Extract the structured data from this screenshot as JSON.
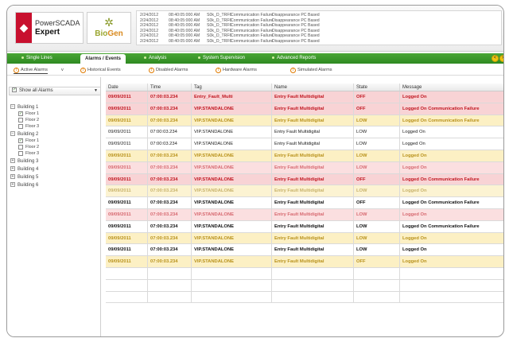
{
  "header": {
    "logo_primary_line1": "PowerSCADA",
    "logo_primary_line2": "Expert",
    "logo_secondary_a": "Bio",
    "logo_secondary_b": "Gen",
    "event_log": [
      {
        "date": "2/24/2012",
        "time": "08:40:05:000 AM",
        "site": "S0k_D_TRF6",
        "msg": "Communication Failure",
        "detail": "Disappearance PC Based"
      },
      {
        "date": "2/24/2012",
        "time": "08:40:05:000 AM",
        "site": "S0k_D_TRF6",
        "msg": "Communication Failure",
        "detail": "Disappearance PC Based"
      },
      {
        "date": "2/24/2012",
        "time": "08:40:05:000 AM",
        "site": "S0k_D_TRF6",
        "msg": "Communication Failure",
        "detail": "Disappearance PC Based"
      },
      {
        "date": "2/24/2012",
        "time": "08:40:05:000 AM",
        "site": "S0k_D_TRF6",
        "msg": "Communication Failure",
        "detail": "Disappearance PC Based"
      },
      {
        "date": "2/24/2012",
        "time": "08:40:05:000 AM",
        "site": "S0k_D_TRF6",
        "msg": "Communication Failure",
        "detail": "Disappearance PC Based"
      },
      {
        "date": "2/24/2012",
        "time": "08:40:05:000 AM",
        "site": "S0k_D_TRF6",
        "msg": "Communication Failure",
        "detail": "Disappearance PC Based"
      }
    ]
  },
  "nav": {
    "items": [
      "Single Lines",
      "Alarms / Events",
      "Analysis",
      "System Supervision",
      "Advanced Reports"
    ],
    "prev_label": "<",
    "next_label": ">"
  },
  "subtabs": {
    "items": [
      "Active Alarms",
      "Historical Events",
      "Disabled Alarms",
      "Hardware Alarms",
      "Simulated Alarms"
    ],
    "dropdown": "v"
  },
  "sidebar": {
    "show_all": "Show all Alarms",
    "tree": [
      {
        "label": "Building 1",
        "floors": [
          "Floor 1",
          "Floor 2",
          "Floor 3"
        ]
      },
      {
        "label": "Building 2",
        "floors": [
          "Floor 1",
          "Floor 2",
          "Floor 3"
        ]
      },
      {
        "label": "Building 3"
      },
      {
        "label": "Building 4"
      },
      {
        "label": "Building 5"
      },
      {
        "label": "Building 6"
      }
    ]
  },
  "table": {
    "columns": [
      "Date",
      "Time",
      "Tag",
      "Name",
      "State",
      "Message"
    ],
    "rows": [
      [
        "09/09/2011",
        "07:00:03.234",
        "Entry_Fault_Multi",
        "Entry Fault Multidigital",
        "OFF",
        "Logged On"
      ],
      [
        "09/09/2011",
        "07:00:03.234",
        "VIP.STANDALONE",
        "Entry Fault Multidigital",
        "OFF",
        "Logged On Communication Failure"
      ],
      [
        "09/09/2011",
        "07:00:03.234",
        "VIP.STANDALONE",
        "Entry Fault Multidigital",
        "LOW",
        "Logged On Communication Failure"
      ],
      [
        "09/09/2011",
        "07:00:03.234",
        "VIP.STANDALONE",
        "Entry Fault Multidigital",
        "LOW",
        "Logged On"
      ],
      [
        "09/09/2011",
        "07:00:03.234",
        "VIP.STANDALONE",
        "Entry Fault Multidigital",
        "LOW",
        "Logged On"
      ],
      [
        "09/09/2011",
        "07:00:03.234",
        "VIP.STANDALONE",
        "Entry Fault Multidigital",
        "LOW",
        "Logged On"
      ],
      [
        "09/09/2011",
        "07:00:03.234",
        "VIP.STANDALONE",
        "Entry Fault Multidigital",
        "LOW",
        "Logged On"
      ],
      [
        "09/09/2011",
        "07:00:03.234",
        "VIP.STANDALONE",
        "Entry Fault Multidigital",
        "OFF",
        "Logged On Communication Failure"
      ],
      [
        "09/09/2011",
        "07:00:03.234",
        "VIP.STANDALONE",
        "Entry Fault Multidigital",
        "LOW",
        "Logged On"
      ],
      [
        "09/09/2011",
        "07:00:03.234",
        "VIP.STANDALONE",
        "Entry Fault Multidigital",
        "OFF",
        "Logged On Communication Failure"
      ],
      [
        "09/09/2011",
        "07:00:03.234",
        "VIP.STANDALONE",
        "Entry Fault Multidigital",
        "LOW",
        "Logged On"
      ],
      [
        "09/09/2011",
        "07:00:03.234",
        "VIP.STANDALONE",
        "Entry Fault Multidigital",
        "LOW",
        "Logged On Communication Failure"
      ],
      [
        "09/09/2011",
        "07:00:03.234",
        "VIP.STANDALONE",
        "Entry Fault Multidigital",
        "LOW",
        "Logged On"
      ],
      [
        "09/09/2011",
        "07:00:03.234",
        "VIP.STANDALONE",
        "Entry Fault Multidigital",
        "LOW",
        "Logged On"
      ],
      [
        "09/09/2011",
        "07:00:03.234",
        "VIP.STANDALONE",
        "Entry Fault Multidigital",
        "OFF",
        "Logged On"
      ]
    ],
    "row_styles": [
      "s-red",
      "s-red",
      "s-yel",
      "s-white",
      "s-white",
      "s-yel",
      "s-redf",
      "s-red",
      "s-yelf",
      "s-whiteb",
      "s-redf",
      "s-whiteb",
      "s-yel",
      "s-whiteb",
      "s-yel"
    ]
  },
  "colors": {
    "nav_green": "#3a9a2b",
    "alarm_red": "#c0151f",
    "alarm_red_bg": "#f8d3d5",
    "warn_yellow": "#b8911a",
    "warn_yellow_bg": "#fcf0c4"
  }
}
